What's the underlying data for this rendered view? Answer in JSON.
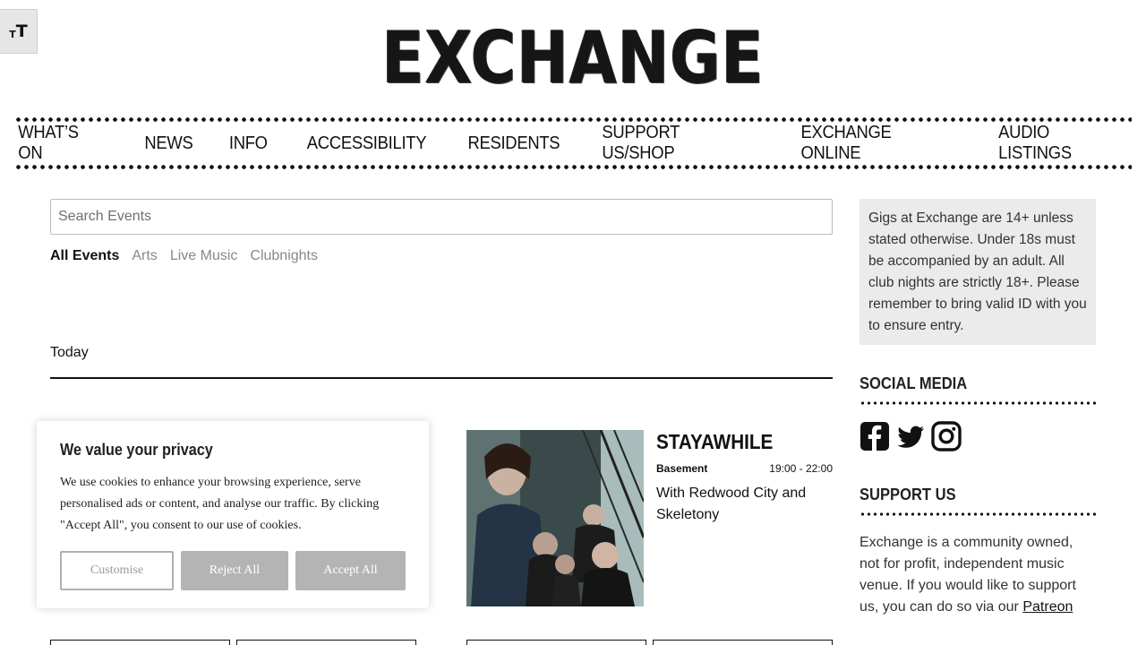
{
  "accessibility": {
    "font_toggle_small": "T",
    "font_toggle_large": "T"
  },
  "brand": {
    "logo_text": "EXCHANGE"
  },
  "nav": {
    "items": [
      {
        "label": "WHAT’S ON"
      },
      {
        "label": "NEWS"
      },
      {
        "label": "INFO"
      },
      {
        "label": "ACCESSIBILITY"
      },
      {
        "label": "RESIDENTS"
      },
      {
        "label": "SUPPORT US/SHOP"
      },
      {
        "label": "EXCHANGE ONLINE"
      },
      {
        "label": "AUDIO LISTINGS"
      }
    ]
  },
  "search": {
    "placeholder": "Search Events",
    "value": ""
  },
  "filters": [
    {
      "label": "All Events",
      "active": true
    },
    {
      "label": "Arts",
      "active": false
    },
    {
      "label": "Live Music",
      "active": false
    },
    {
      "label": "Clubnights",
      "active": false
    }
  ],
  "listing": {
    "section_label": "Today",
    "events": [
      {
        "title": "STAYAWHILE",
        "venue": "Basement",
        "time": "19:00 - 22:00",
        "description": "With Redwood City and Skeletony"
      }
    ]
  },
  "sidebar": {
    "notice": "Gigs at Exchange are 14+ unless stated otherwise. Under 18s must be accompanied by an adult. All club nights are strictly 18+. Please remember to bring valid ID with you to ensure entry.",
    "social_heading": "SOCIAL MEDIA",
    "social_icons": [
      "facebook-icon",
      "twitter-icon",
      "instagram-icon"
    ],
    "support_heading": "SUPPORT US",
    "support_text": "Exchange is a community owned, not for profit, independent music venue. If you would like to support us, you can do so via our",
    "support_link": "Patreon"
  },
  "cookie_banner": {
    "title": "We value your privacy",
    "body": "We use cookies to enhance your browsing experience, serve personalised ads or content, and analyse our traffic. By clicking \"Accept All\", you consent to our use of cookies.",
    "customise_label": "Customise",
    "reject_label": "Reject All",
    "accept_label": "Accept All"
  },
  "colors": {
    "text": "#111111",
    "muted": "#888888",
    "notice_bg": "#ebebeb",
    "cookie_button": "#b4b4b4"
  }
}
